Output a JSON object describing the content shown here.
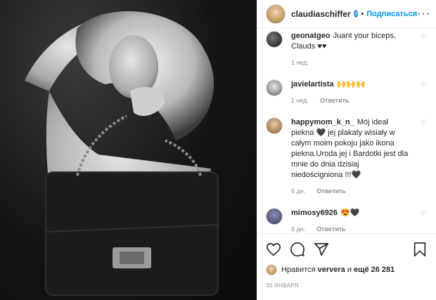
{
  "header": {
    "username": "claudiaschiffer",
    "separator": "•",
    "follow_label": "Подписаться",
    "more_label": "···"
  },
  "comments": [
    {
      "user": "geonatgeo",
      "text": "Juant your biceps, Clauds ♥♥",
      "time": "1 нед.",
      "reply": ""
    },
    {
      "user": "javielartista",
      "text": "🙌🙌🙌",
      "time": "1 нед.",
      "reply": "Ответить"
    },
    {
      "user": "happymom_k_n_",
      "text": "Mój ideał piekna 🖤 jej plakaty wisiały w całym moim pokoju jako ikona piekna.Uroda jej i Bardotki jest dla mnie do dnia dzisiaj niedościgniona !!!🖤",
      "time": "6 дн.",
      "reply": "Ответить"
    },
    {
      "user": "mimosy6926",
      "text": "😍🖤",
      "time": "6 дн.",
      "reply": "Ответить"
    }
  ],
  "likes": {
    "prefix": "Нравится",
    "user": "ververa",
    "middle": "и",
    "count": "ещё 26 281"
  },
  "date": "30 ЯНВАРЯ"
}
